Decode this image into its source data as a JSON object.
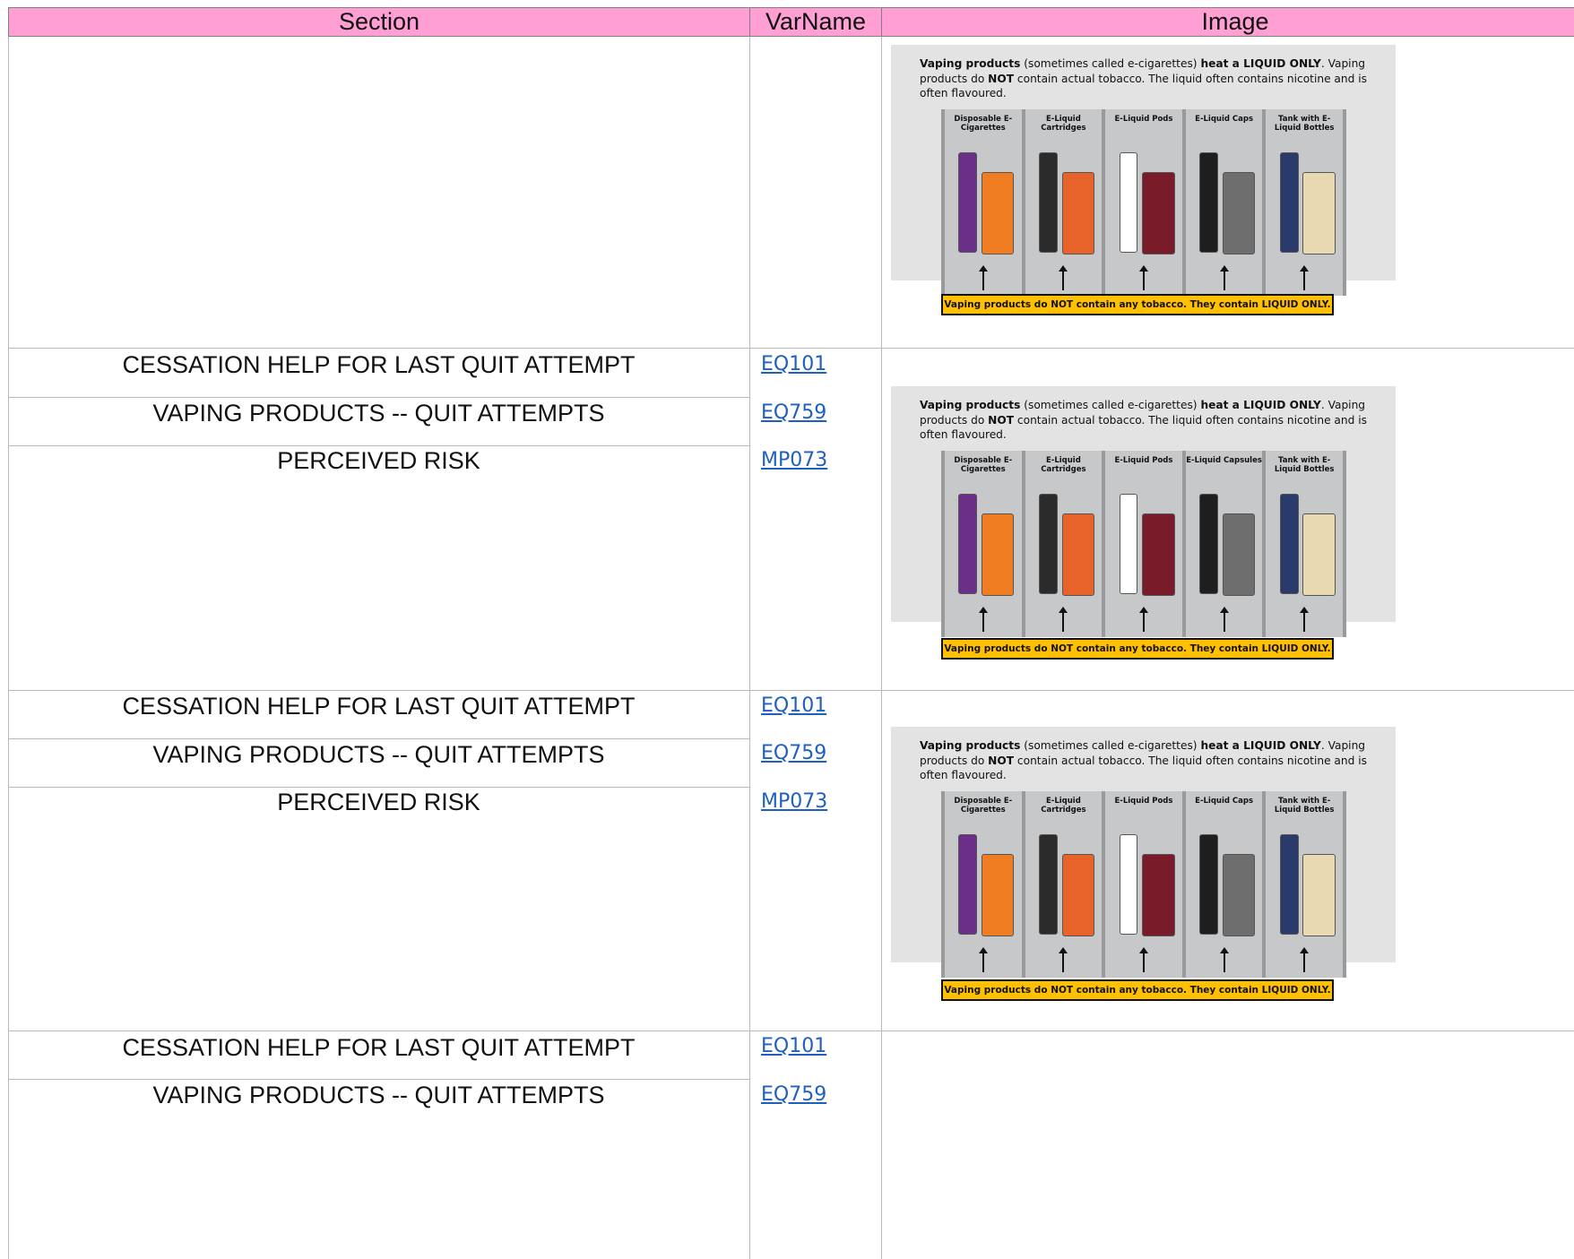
{
  "header": {
    "section": "Section",
    "varname": "VarName",
    "image": "Image"
  },
  "rows": [
    {
      "section": "CESSATION HELP FOR LAST QUIT ATTEMPT",
      "var": "EQ101"
    },
    {
      "section": "VAPING PRODUCTS -- QUIT ATTEMPTS",
      "var": "EQ759"
    },
    {
      "section": "PERCEIVED RISK",
      "var": "MP073"
    },
    {
      "section": "CESSATION HELP FOR LAST QUIT ATTEMPT",
      "var": "EQ101"
    },
    {
      "section": "VAPING PRODUCTS -- QUIT ATTEMPTS",
      "var": "EQ759"
    },
    {
      "section": "PERCEIVED RISK",
      "var": "MP073"
    },
    {
      "section": "CESSATION HELP FOR LAST QUIT ATTEMPT",
      "var": "EQ101"
    },
    {
      "section": "VAPING PRODUCTS -- QUIT ATTEMPTS",
      "var": "EQ759"
    }
  ],
  "panels": [
    {
      "intro_bold1": "Vaping products",
      "intro_mid": " (sometimes called e-cigarettes) ",
      "intro_bold2": "heat a LIQUID ONLY",
      "intro_line2a": ". Vaping products do ",
      "intro_bold3": "NOT",
      "intro_line2b": " contain actual tobacco. The liquid often contains nicotine and is often flavoured.",
      "columns": [
        "Disposable E-Cigarettes",
        "E-Liquid Cartridges",
        "E-Liquid Pods",
        "E-Liquid Caps",
        "Tank with E-Liquid Bottles"
      ],
      "banner": "Vaping products do NOT contain any tobacco. They contain LIQUID ONLY."
    },
    {
      "intro_bold1": "Vaping products",
      "intro_mid": " (sometimes called e-cigarettes) ",
      "intro_bold2": "heat a LIQUID ONLY",
      "intro_line2a": ". Vaping products do ",
      "intro_bold3": "NOT",
      "intro_line2b": " contain actual tobacco. The liquid often contains nicotine and is often flavoured.",
      "columns": [
        "Disposable E-Cigarettes",
        "E-Liquid Cartridges",
        "E-Liquid Pods",
        "E-Liquid Capsules",
        "Tank with E-Liquid Bottles"
      ],
      "banner": "Vaping products do NOT contain any tobacco. They contain LIQUID ONLY."
    },
    {
      "intro_bold1": "Vaping products",
      "intro_mid": " (sometimes called e-cigarettes) ",
      "intro_bold2": "heat a LIQUID ONLY",
      "intro_line2a": ". Vaping products do ",
      "intro_bold3": "NOT",
      "intro_line2b": " contain actual tobacco. The liquid often contains nicotine and is often flavoured.",
      "columns": [
        "Disposable E-Cigarettes",
        "E-Liquid Cartridges",
        "E-Liquid Pods",
        "E-Liquid Caps",
        "Tank with E-Liquid Bottles"
      ],
      "banner": "Vaping products do NOT contain any tobacco. They contain LIQUID ONLY."
    }
  ]
}
